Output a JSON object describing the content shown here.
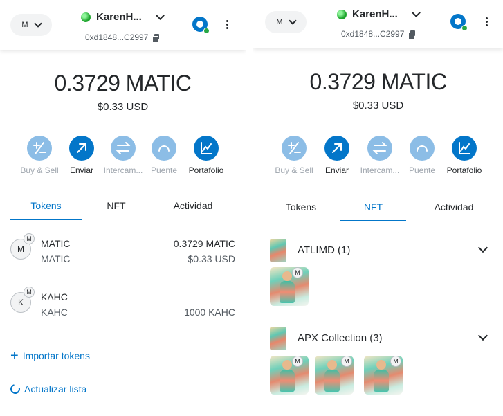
{
  "left": {
    "header": {
      "network_initial": "M",
      "account_name": "KarenH...",
      "address": "0xd1848...C2997"
    },
    "balance": {
      "amount": "0.3729 MATIC",
      "fiat": "$0.33 USD"
    },
    "actions": [
      {
        "label": "Buy & Sell",
        "icon": "buy-sell-icon",
        "active": false
      },
      {
        "label": "Enviar",
        "icon": "send-arrow-icon",
        "active": true
      },
      {
        "label": "Intercam...",
        "icon": "swap-icon",
        "active": false
      },
      {
        "label": "Puente",
        "icon": "bridge-icon",
        "active": false
      },
      {
        "label": "Portafolio",
        "icon": "portfolio-chart-icon",
        "active": true
      }
    ],
    "tabs": [
      {
        "label": "Tokens",
        "active": true
      },
      {
        "label": "NFT",
        "active": false
      },
      {
        "label": "Actividad",
        "active": false
      }
    ],
    "tokens": [
      {
        "initial": "M",
        "badge": "M",
        "name": "MATIC",
        "symbol": "MATIC",
        "amount": "0.3729 MATIC",
        "fiat": "$0.33 USD"
      },
      {
        "initial": "K",
        "badge": "M",
        "name": "KAHC",
        "symbol": "KAHC",
        "amount": "1000 KAHC",
        "fiat": ""
      }
    ],
    "links": {
      "import": "Importar tokens",
      "refresh": "Actualizar lista"
    }
  },
  "right": {
    "header": {
      "network_initial": "M",
      "account_name": "KarenH...",
      "address": "0xd1848...C2997"
    },
    "balance": {
      "amount": "0.3729 MATIC",
      "fiat": "$0.33 USD"
    },
    "actions": [
      {
        "label": "Buy & Sell",
        "icon": "buy-sell-icon",
        "active": false
      },
      {
        "label": "Enviar",
        "icon": "send-arrow-icon",
        "active": true
      },
      {
        "label": "Intercam...",
        "icon": "swap-icon",
        "active": false
      },
      {
        "label": "Puente",
        "icon": "bridge-icon",
        "active": false
      },
      {
        "label": "Portafolio",
        "icon": "portfolio-chart-icon",
        "active": true
      }
    ],
    "tabs": [
      {
        "label": "Tokens",
        "active": false
      },
      {
        "label": "NFT",
        "active": true
      },
      {
        "label": "Actividad",
        "active": false
      }
    ],
    "collections": [
      {
        "name": "ATLIMD (1)",
        "item_badges": [
          "M"
        ]
      },
      {
        "name": "APX Collection (3)",
        "item_badges": [
          "M",
          "M",
          "M"
        ]
      }
    ]
  },
  "colors": {
    "accent": "#0376c9",
    "accent_dim": "#8cbde6",
    "text": "#24272a",
    "muted": "#535a61",
    "online": "#28a745"
  }
}
